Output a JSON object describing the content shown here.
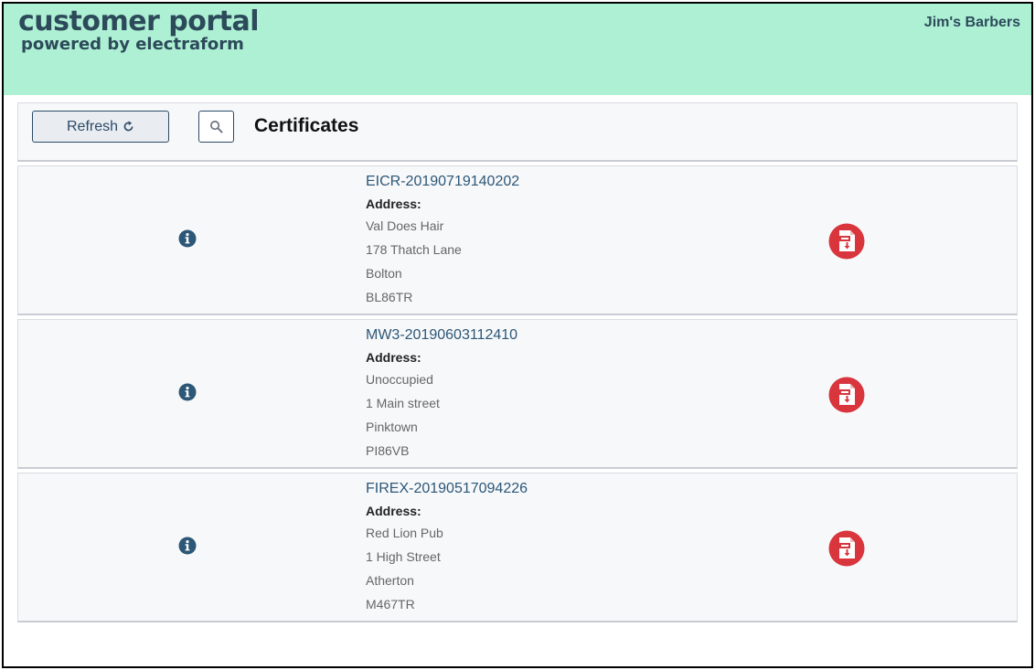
{
  "header": {
    "brand_title": "customer portal",
    "brand_subtitle": "powered by electraform",
    "account_name": "Jim's Barbers"
  },
  "toolbar": {
    "refresh_label": "Refresh",
    "page_title": "Certificates"
  },
  "certificates": [
    {
      "name": "EICR-20190719140202",
      "address_label": "Address:",
      "address": [
        "Val Does Hair",
        "178 Thatch Lane",
        "Bolton",
        "BL86TR"
      ]
    },
    {
      "name": "MW3-20190603112410",
      "address_label": "Address:",
      "address": [
        "Unoccupied",
        "1 Main street",
        "Pinktown",
        "PI86VB"
      ]
    },
    {
      "name": "FIREX-20190517094226",
      "address_label": "Address:",
      "address": [
        "Red Lion Pub",
        "1 High Street",
        "Atherton",
        "M467TR"
      ]
    }
  ],
  "icons": {
    "refresh": "refresh-icon",
    "search": "search-icon",
    "info": "info-icon",
    "pdf": "pdf-download-icon"
  },
  "colors": {
    "header_bg": "#aef0d4",
    "brand_text": "#2c4a5a",
    "link": "#2c5777",
    "pdf_red": "#d8353d"
  }
}
